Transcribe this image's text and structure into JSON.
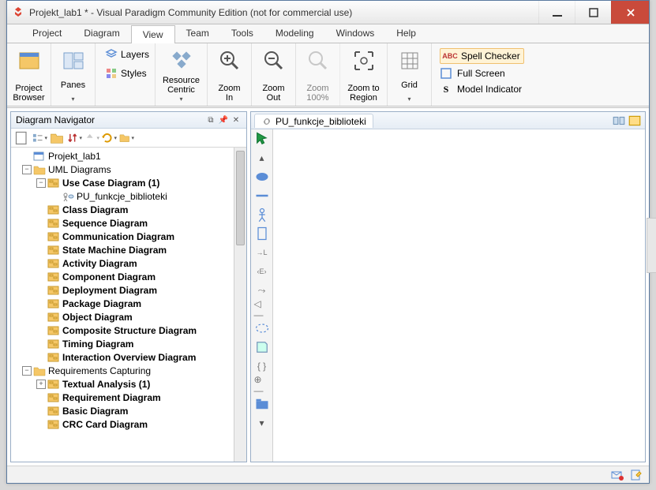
{
  "window": {
    "title": "Projekt_lab1 * - Visual Paradigm Community Edition (not for commercial use)"
  },
  "menus": [
    "Project",
    "Diagram",
    "View",
    "Team",
    "Tools",
    "Modeling",
    "Windows",
    "Help"
  ],
  "menu_active": 2,
  "ribbon": {
    "project_browser": "Project\nBrowser",
    "panes": "Panes",
    "layers": "Layers",
    "styles": "Styles",
    "resource_centric": "Resource\nCentric",
    "zoom_in": "Zoom\nIn",
    "zoom_out": "Zoom\nOut",
    "zoom_100": "Zoom\n100%",
    "zoom_region": "Zoom to\nRegion",
    "grid": "Grid",
    "spell_checker": "Spell Checker",
    "full_screen": "Full Screen",
    "model_indicator": "Model Indicator"
  },
  "navigator": {
    "title": "Diagram Navigator"
  },
  "tree": [
    {
      "d": 0,
      "exp": "",
      "icon": "proj",
      "label": "Projekt_lab1",
      "bold": false
    },
    {
      "d": 0,
      "exp": "-",
      "icon": "folder",
      "label": "UML Diagrams",
      "bold": false
    },
    {
      "d": 1,
      "exp": "-",
      "icon": "diag",
      "label": "Use Case Diagram (1)",
      "bold": true
    },
    {
      "d": 2,
      "exp": "",
      "icon": "uc",
      "label": "PU_funkcje_biblioteki",
      "bold": false
    },
    {
      "d": 1,
      "exp": "",
      "icon": "diag",
      "label": "Class Diagram",
      "bold": true
    },
    {
      "d": 1,
      "exp": "",
      "icon": "diag",
      "label": "Sequence Diagram",
      "bold": true
    },
    {
      "d": 1,
      "exp": "",
      "icon": "diag",
      "label": "Communication Diagram",
      "bold": true
    },
    {
      "d": 1,
      "exp": "",
      "icon": "diag",
      "label": "State Machine Diagram",
      "bold": true
    },
    {
      "d": 1,
      "exp": "",
      "icon": "diag",
      "label": "Activity Diagram",
      "bold": true
    },
    {
      "d": 1,
      "exp": "",
      "icon": "diag",
      "label": "Component Diagram",
      "bold": true
    },
    {
      "d": 1,
      "exp": "",
      "icon": "diag",
      "label": "Deployment Diagram",
      "bold": true
    },
    {
      "d": 1,
      "exp": "",
      "icon": "diag",
      "label": "Package Diagram",
      "bold": true
    },
    {
      "d": 1,
      "exp": "",
      "icon": "diag",
      "label": "Object Diagram",
      "bold": true
    },
    {
      "d": 1,
      "exp": "",
      "icon": "diag",
      "label": "Composite Structure Diagram",
      "bold": true
    },
    {
      "d": 1,
      "exp": "",
      "icon": "diag",
      "label": "Timing Diagram",
      "bold": true
    },
    {
      "d": 1,
      "exp": "",
      "icon": "diag",
      "label": "Interaction Overview Diagram",
      "bold": true
    },
    {
      "d": 0,
      "exp": "-",
      "icon": "folder",
      "label": "Requirements Capturing",
      "bold": false
    },
    {
      "d": 1,
      "exp": "+",
      "icon": "diag",
      "label": "Textual Analysis (1)",
      "bold": true
    },
    {
      "d": 1,
      "exp": "",
      "icon": "diag",
      "label": "Requirement Diagram",
      "bold": true
    },
    {
      "d": 1,
      "exp": "",
      "icon": "diag",
      "label": "Basic Diagram",
      "bold": true
    },
    {
      "d": 1,
      "exp": "",
      "icon": "diag",
      "label": "CRC Card Diagram",
      "bold": true
    }
  ],
  "editor_tab": "PU_funkcje_biblioteki"
}
